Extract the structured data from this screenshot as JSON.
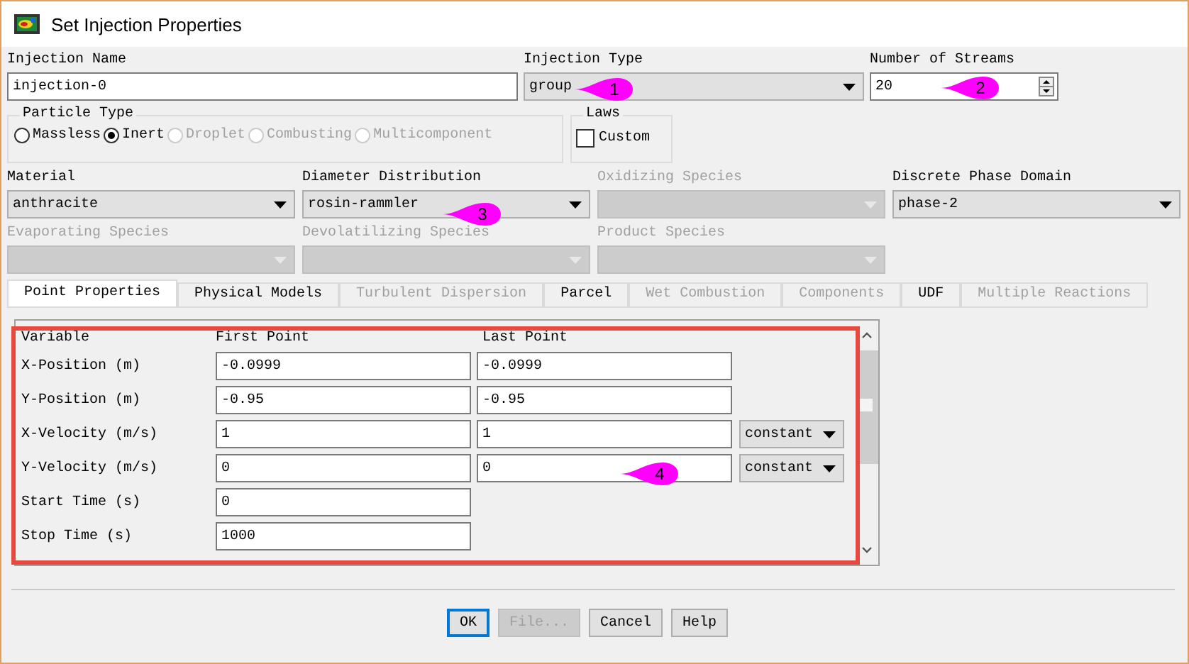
{
  "window": {
    "title": "Set Injection Properties"
  },
  "injection_name": {
    "label": "Injection Name",
    "value": "injection-0"
  },
  "injection_type": {
    "label": "Injection Type",
    "value": "group"
  },
  "number_of_streams": {
    "label": "Number of Streams",
    "value": "20"
  },
  "particle_type": {
    "label": "Particle Type",
    "options": [
      {
        "label": "Massless",
        "selected": false,
        "disabled": false
      },
      {
        "label": "Inert",
        "selected": true,
        "disabled": false
      },
      {
        "label": "Droplet",
        "selected": false,
        "disabled": true
      },
      {
        "label": "Combusting",
        "selected": false,
        "disabled": true
      },
      {
        "label": "Multicomponent",
        "selected": false,
        "disabled": true
      }
    ]
  },
  "laws": {
    "label": "Laws",
    "custom": {
      "label": "Custom",
      "checked": false
    }
  },
  "selects_row_1": [
    {
      "label": "Material",
      "value": "anthracite",
      "disabled": false
    },
    {
      "label": "Diameter Distribution",
      "value": "rosin-rammler",
      "disabled": false
    },
    {
      "label": "Oxidizing Species",
      "disabled": true
    },
    {
      "label": "Discrete Phase Domain",
      "value": "phase-2",
      "disabled": false
    }
  ],
  "selects_row_2": [
    {
      "label": "Evaporating Species",
      "disabled": true
    },
    {
      "label": "Devolatilizing Species",
      "disabled": true
    },
    {
      "label": "Product Species",
      "disabled": true
    }
  ],
  "tabs": [
    {
      "label": "Point Properties",
      "selected": true,
      "disabled": false
    },
    {
      "label": "Physical Models",
      "selected": false,
      "disabled": false
    },
    {
      "label": "Turbulent Dispersion",
      "selected": false,
      "disabled": true
    },
    {
      "label": "Parcel",
      "selected": false,
      "disabled": false
    },
    {
      "label": "Wet Combustion",
      "selected": false,
      "disabled": true
    },
    {
      "label": "Components",
      "selected": false,
      "disabled": true
    },
    {
      "label": "UDF",
      "selected": false,
      "disabled": false
    },
    {
      "label": "Multiple Reactions",
      "selected": false,
      "disabled": true
    }
  ],
  "point_properties": {
    "columns": [
      "Variable",
      "First Point",
      "Last Point"
    ],
    "rows": [
      {
        "variable": "X-Position (m)",
        "first": "-0.0999",
        "last": "-0.0999"
      },
      {
        "variable": "Y-Position (m)",
        "first": "-0.95",
        "last": "-0.95"
      },
      {
        "variable": "X-Velocity (m/s)",
        "first": "1",
        "last": "1",
        "mode": "constant"
      },
      {
        "variable": "Y-Velocity (m/s)",
        "first": "0",
        "last": "0",
        "mode": "constant"
      },
      {
        "variable": "Start Time (s)",
        "first": "0"
      },
      {
        "variable": "Stop Time (s)",
        "first": "1000"
      }
    ]
  },
  "buttons": [
    {
      "label": "OK",
      "disabled": false,
      "default": true
    },
    {
      "label": "File...",
      "disabled": true,
      "default": false
    },
    {
      "label": "Cancel",
      "disabled": false,
      "default": false
    },
    {
      "label": "Help",
      "disabled": false,
      "default": false
    }
  ],
  "callouts": [
    {
      "label": "1"
    },
    {
      "label": "2"
    },
    {
      "label": "3"
    },
    {
      "label": "4"
    }
  ]
}
